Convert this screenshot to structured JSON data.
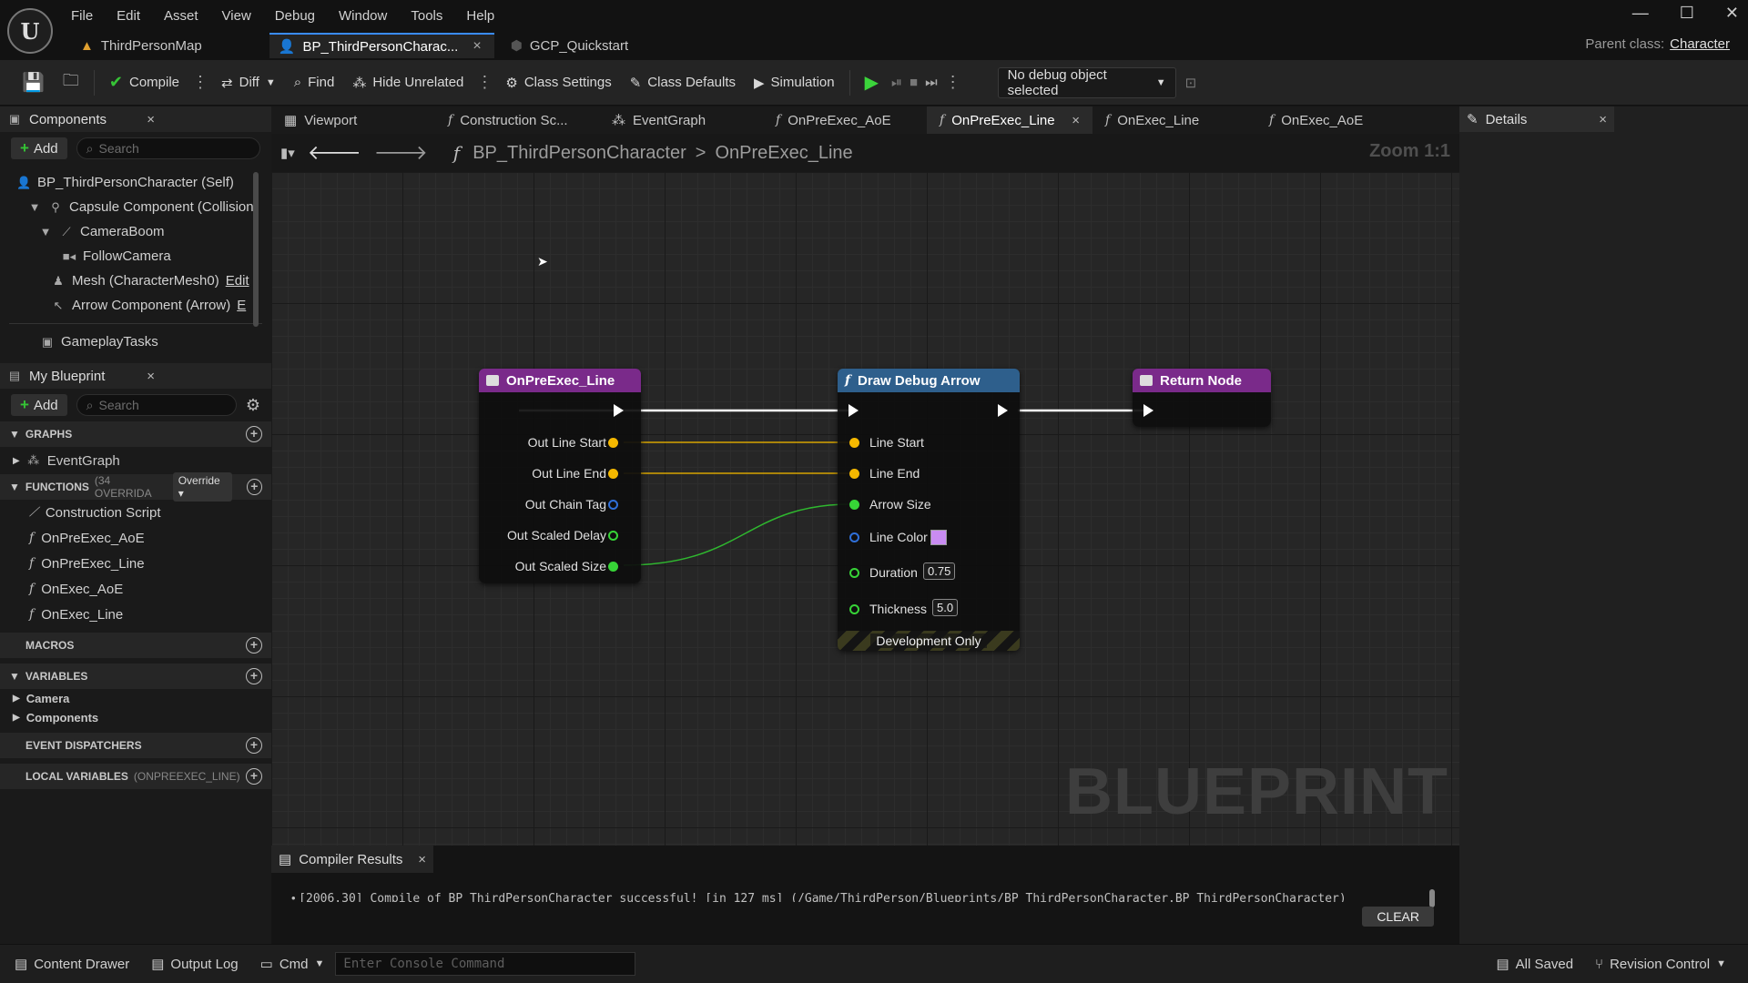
{
  "app": {
    "menu": [
      "File",
      "Edit",
      "Asset",
      "View",
      "Debug",
      "Window",
      "Tools",
      "Help"
    ],
    "doc_tabs": [
      {
        "label": "ThirdPersonMap"
      },
      {
        "label": "BP_ThirdPersonCharac..."
      },
      {
        "label": "GCP_Quickstart"
      }
    ],
    "parent_class_label": "Parent class:",
    "parent_class_value": "Character"
  },
  "toolbar": {
    "compile": "Compile",
    "diff": "Diff",
    "find": "Find",
    "hide_unrelated": "Hide Unrelated",
    "class_settings": "Class Settings",
    "class_defaults": "Class Defaults",
    "simulation": "Simulation",
    "debug_object": "No debug object selected"
  },
  "components_panel": {
    "tab": "Components",
    "add": "Add",
    "search_placeholder": "Search",
    "items": [
      {
        "label": "BP_ThirdPersonCharacter (Self)",
        "icon": "person-icon"
      },
      {
        "label": "Capsule Component (Collision(",
        "icon": "capsule-icon"
      },
      {
        "label": "CameraBoom",
        "icon": "boom-icon"
      },
      {
        "label": "FollowCamera",
        "icon": "camera-icon"
      },
      {
        "label": "Mesh (CharacterMesh0)",
        "extra": "Edit",
        "icon": "mesh-icon"
      },
      {
        "label": "Arrow Component (Arrow)",
        "extra": "E",
        "icon": "arrow-icon"
      },
      {
        "label": "GameplayTasks",
        "icon": "component-icon"
      }
    ]
  },
  "my_blueprint": {
    "tab": "My Blueprint",
    "add": "Add",
    "search_placeholder": "Search",
    "graphs_header": "GRAPHS",
    "graphs": [
      "EventGraph"
    ],
    "functions_header": "FUNCTIONS",
    "functions_sub": "(34 OVERRIDA",
    "override_label": "Override",
    "functions": [
      "Construction Script",
      "OnPreExec_AoE",
      "OnPreExec_Line",
      "OnExec_AoE",
      "OnExec_Line"
    ],
    "macros_header": "MACROS",
    "variables_header": "VARIABLES",
    "variables": [
      "Camera",
      "Components"
    ],
    "dispatchers_header": "EVENT DISPATCHERS",
    "locals_header": "LOCAL VARIABLES",
    "locals_sub": "(ONPREEXEC_LINE)"
  },
  "graph_tabs": [
    {
      "label": "Viewport"
    },
    {
      "label": "Construction Sc..."
    },
    {
      "label": "EventGraph"
    },
    {
      "label": "OnPreExec_AoE"
    },
    {
      "label": "OnPreExec_Line"
    },
    {
      "label": "OnExec_Line"
    },
    {
      "label": "OnExec_AoE"
    }
  ],
  "breadcrumb": {
    "root": "BP_ThirdPersonCharacter",
    "sep": ">",
    "current": "OnPreExec_Line"
  },
  "zoom": "Zoom 1:1",
  "watermark": "BLUEPRINT",
  "nodes": {
    "entry": {
      "title": "OnPreExec_Line",
      "header_color": "#7a2a8a",
      "pins": [
        "Out Line Start",
        "Out Line End",
        "Out Chain Tag",
        "Out Scaled Delay",
        "Out Scaled Size"
      ]
    },
    "draw": {
      "title": "Draw Debug Arrow",
      "header_color": "#2e5f8c",
      "pins": [
        "Line Start",
        "Line End",
        "Arrow Size",
        "Line Color",
        "Duration",
        "Thickness"
      ],
      "duration_value": "0.75",
      "thickness_value": "5.0",
      "line_color": "#c98cf2",
      "footer": "Development Only"
    },
    "ret": {
      "title": "Return Node",
      "header_color": "#7a2a8a"
    }
  },
  "compiler": {
    "tab": "Compiler Results",
    "message": "[2006.30] Compile of BP_ThirdPersonCharacter successful! [in 127 ms] (/Game/ThirdPerson/Blueprints/BP_ThirdPersonCharacter.BP_ThirdPersonCharacter)",
    "clear": "CLEAR"
  },
  "details": {
    "tab": "Details"
  },
  "statusbar": {
    "content_drawer": "Content Drawer",
    "output_log": "Output Log",
    "cmd": "Cmd",
    "console_placeholder": "Enter Console Command",
    "all_saved": "All Saved",
    "revision_control": "Revision Control"
  },
  "colors": {
    "accent": "#3a8cff",
    "vector_pin": "#f5b800",
    "float_pin": "#37d437",
    "struct_pin": "#2f6fd8"
  }
}
